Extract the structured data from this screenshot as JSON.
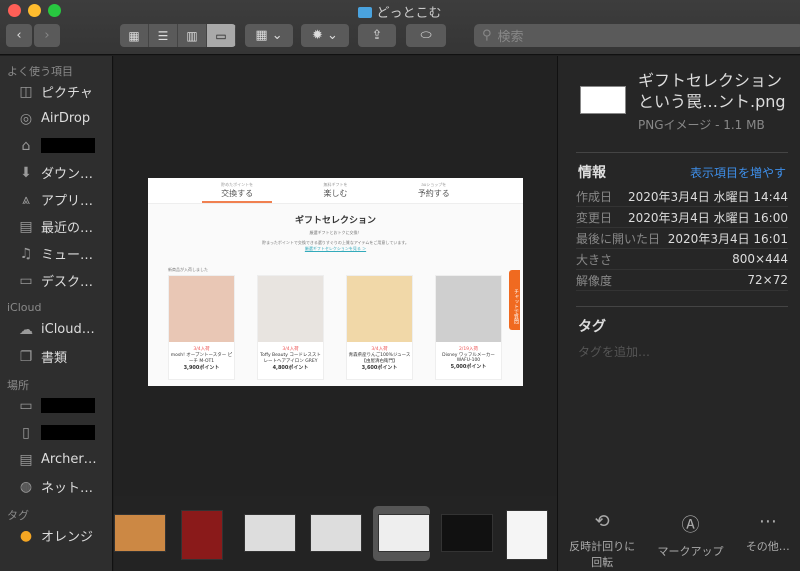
{
  "window": {
    "title": "どっとこむ"
  },
  "toolbar": {
    "back": "‹",
    "forward": "›",
    "views": [
      "▦",
      "☰",
      "▥",
      "▭"
    ],
    "group": "▦ ⌄",
    "action": "✹ ⌄",
    "share": "⇪",
    "tag": "⬭",
    "search_placeholder": "検索"
  },
  "sidebar": {
    "favorites_header": "よく使う項目",
    "favorites": [
      {
        "icon": "camera-icon",
        "g": "◫",
        "label": "ピクチャ"
      },
      {
        "icon": "airdrop-icon",
        "g": "◎",
        "label": "AirDrop"
      },
      {
        "icon": "home-icon",
        "g": "⌂",
        "label": ""
      },
      {
        "icon": "download-icon",
        "g": "⬇",
        "label": "ダウン…"
      },
      {
        "icon": "applications-icon",
        "g": "⩓",
        "label": "アプリ…"
      },
      {
        "icon": "recents-icon",
        "g": "▤",
        "label": "最近の…"
      },
      {
        "icon": "music-icon",
        "g": "♫",
        "label": "ミュー…"
      },
      {
        "icon": "desktop-icon",
        "g": "▭",
        "label": "デスク…"
      }
    ],
    "icloud_header": "iCloud",
    "icloud": [
      {
        "icon": "cloud-icon",
        "g": "☁",
        "label": "iCloud…"
      },
      {
        "icon": "documents-icon",
        "g": "❐",
        "label": "書類"
      }
    ],
    "locations_header": "場所",
    "locations": [
      {
        "icon": "laptop-icon",
        "g": "▭",
        "label": ""
      },
      {
        "icon": "ipad-icon",
        "g": "▯",
        "label": ""
      },
      {
        "icon": "server-icon",
        "g": "▤",
        "label": "Archer…"
      },
      {
        "icon": "network-icon",
        "g": "◍",
        "label": "ネット…"
      }
    ],
    "tags_header": "タグ",
    "tags": [
      {
        "label": "オレンジ",
        "color": "#f5a623"
      }
    ]
  },
  "preview": {
    "tabs": [
      {
        "small": "貯めたポイントを",
        "label": "交換する"
      },
      {
        "small": "無料ギフトを",
        "label": "楽しむ"
      },
      {
        "small": "auショップを",
        "label": "予約する"
      }
    ],
    "heading": "ギフトセレクション",
    "desc1": "厳選ギフトとおトクに交換！",
    "desc2": "貯まったポイントで交換できる選りすぐりの上質なアイテムをご用意しています。",
    "link": "厳選ギフトセレクションを見る ＞",
    "new_label": "新商品が入荷しました",
    "chat": "チャットで質問",
    "cards": [
      {
        "stock": "3/4入荷",
        "name": "mosh! オーブントースター ピーチ M-OT1",
        "points": "3,900ポイント",
        "bg": "#e9c7b5"
      },
      {
        "stock": "3/4入荷",
        "name": "Toffy Beauty コードレスストレートヘアアイロン GREY",
        "points": "4,800ポイント",
        "bg": "#e8e4e0"
      },
      {
        "stock": "3/4入荷",
        "name": "青森県産りんご100%ジュース【由屋清右衛門】",
        "points": "3,600ポイント",
        "bg": "#f1d8a8"
      },
      {
        "stock": "2/19入荷",
        "name": "Disney ワッフルメーカー WAFU-100",
        "points": "5,000ポイント",
        "bg": "#cfcfcf"
      }
    ]
  },
  "info": {
    "filename": "ギフトセレクション\nという罠…ント.png",
    "kind": "PNGイメージ - 1.1 MB",
    "header": "情報",
    "show_more": "表示項目を増やす",
    "rows": [
      {
        "k": "作成日",
        "v": "2020年3月4日 水曜日 14:44"
      },
      {
        "k": "変更日",
        "v": "2020年3月4日 水曜日 16:00"
      },
      {
        "k": "最後に開いた日",
        "v": "2020年3月4日 16:01"
      },
      {
        "k": "大きさ",
        "v": "800×444"
      },
      {
        "k": "解像度",
        "v": "72×72"
      }
    ],
    "tags_header": "タグ",
    "tags_placeholder": "タグを追加…"
  },
  "actions": [
    {
      "icon": "rotate-left-icon",
      "g": "⟲",
      "label": "反時計回りに\n回転"
    },
    {
      "icon": "markup-icon",
      "g": "Ⓐ",
      "label": "マークアップ"
    },
    {
      "icon": "more-icon",
      "g": "⋯",
      "label": "その他…"
    }
  ],
  "thumbnails": [
    "#c84",
    "#8a1a1a",
    "#ddd",
    "#ddd",
    "#eee",
    "#111",
    "#f5f5f5"
  ]
}
